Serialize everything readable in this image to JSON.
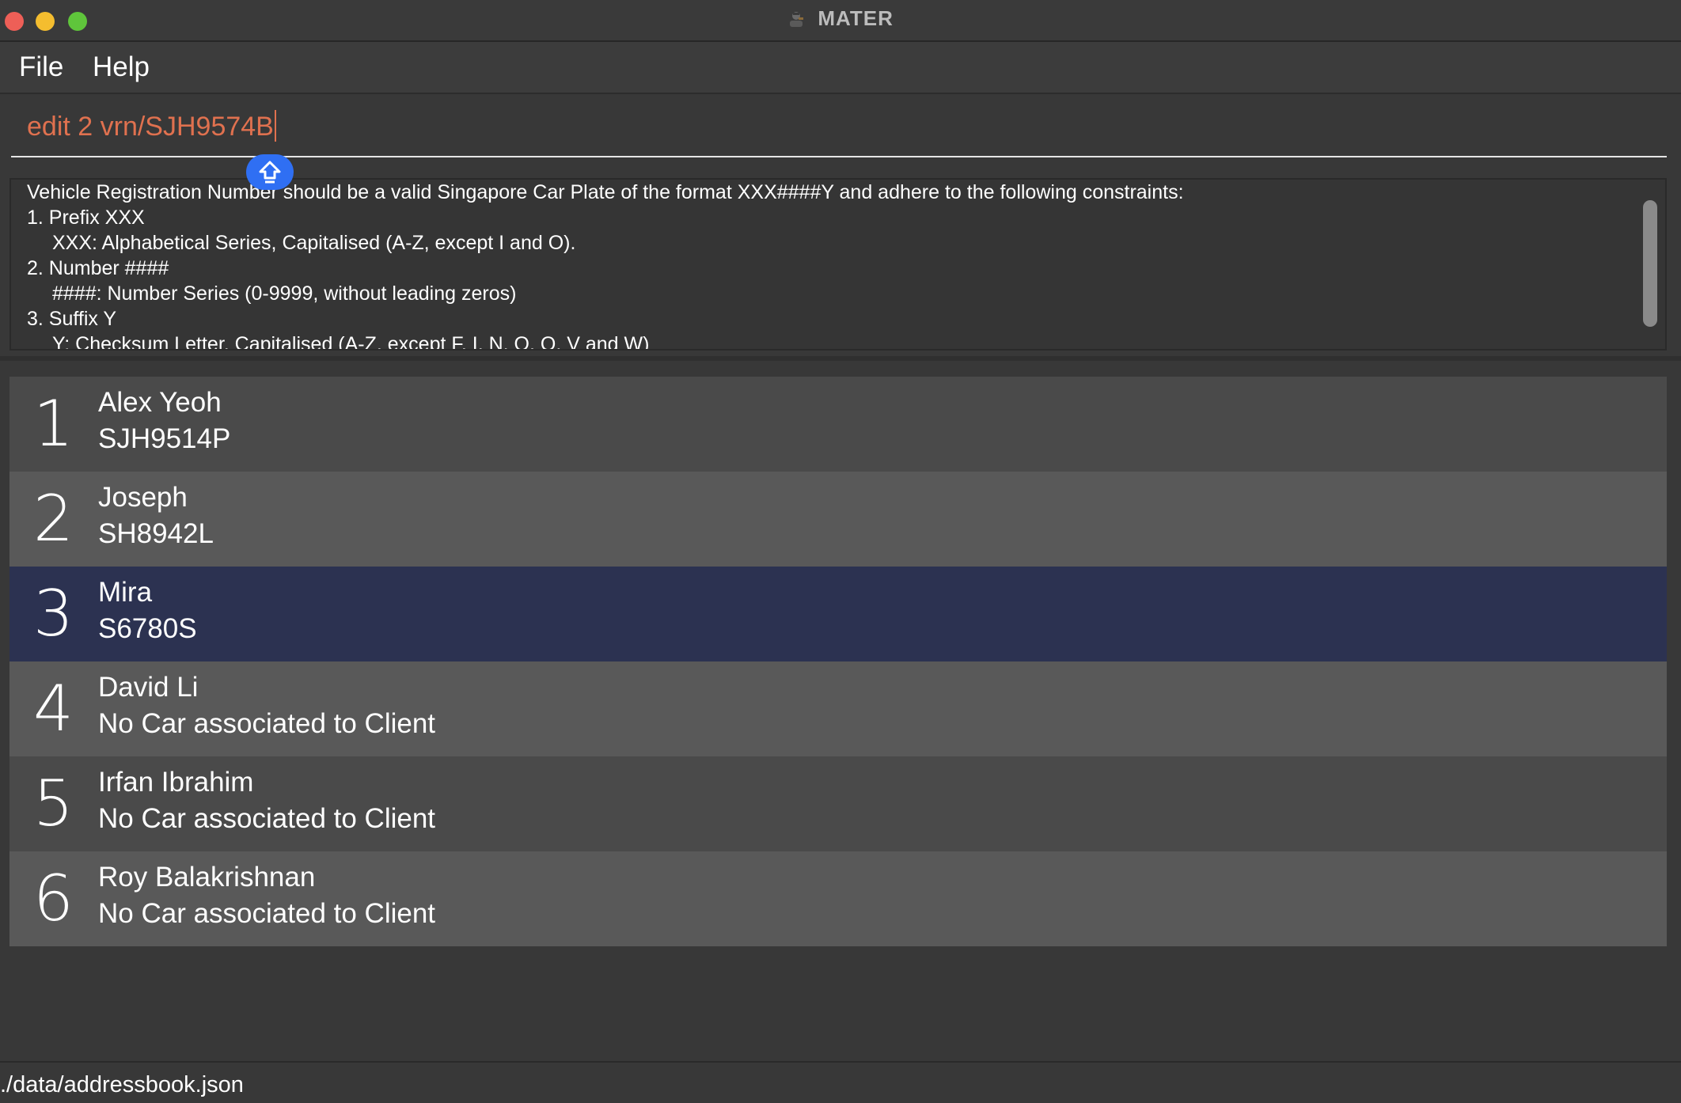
{
  "window": {
    "title": "MATER",
    "app_icon": "mechanic-icon"
  },
  "menu": {
    "file_label": "File",
    "help_label": "Help"
  },
  "command": {
    "value": "edit 2 vrn/SJH9574B",
    "color": "#e0714f"
  },
  "result": {
    "lines": [
      "Vehicle Registration Number should be a valid Singapore Car Plate of the format XXX####Y and adhere to the following constraints:",
      "1. Prefix XXX",
      "XXX: Alphabetical Series, Capitalised (A-Z, except I and O).",
      "2. Number ####",
      "####: Number Series (0-9999, without leading zeros)",
      "3. Suffix Y",
      "Y: Checksum Letter, Capitalised (A-Z, except F, I, N, O, Q, V and W)"
    ]
  },
  "clients": [
    {
      "index": "1",
      "name": "Alex Yeoh",
      "vrn": "SJH9514P"
    },
    {
      "index": "2",
      "name": "Joseph",
      "vrn": "SH8942L"
    },
    {
      "index": "3",
      "name": "Mira",
      "vrn": "S6780S"
    },
    {
      "index": "4",
      "name": "David Li",
      "vrn": "No Car associated to Client"
    },
    {
      "index": "5",
      "name": "Irfan Ibrahim",
      "vrn": "No Car associated to Client"
    },
    {
      "index": "6",
      "name": "Roy Balakrishnan",
      "vrn": "No Car associated to Client"
    }
  ],
  "selected_client_index": "3",
  "status": {
    "file_path": "./data/addressbook.json"
  },
  "colors": {
    "selected_row": "#2c3251",
    "shift_badge": "#2f6ff3"
  }
}
